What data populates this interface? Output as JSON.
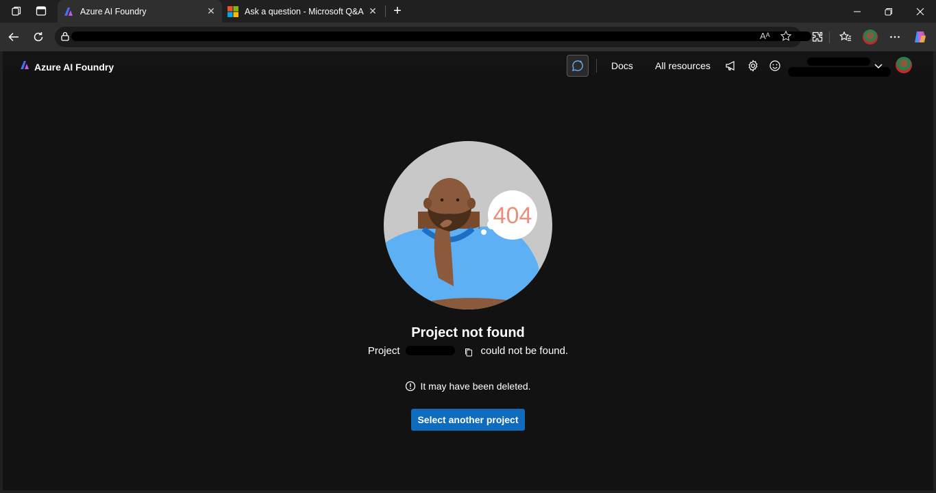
{
  "browser": {
    "tabs": [
      {
        "title": "Azure AI Foundry",
        "active": true
      },
      {
        "title": "Ask a question - Microsoft Q&A",
        "active": false
      }
    ],
    "new_tab_symbol": "+",
    "read_aloud_glyph": "Aᴬ"
  },
  "app": {
    "brand_title": "Azure AI Foundry",
    "nav": {
      "docs": "Docs",
      "all_resources": "All resources"
    }
  },
  "error": {
    "code": "404",
    "title": "Project not found",
    "message_prefix": "Project",
    "message_suffix": "could not be found.",
    "note": "It may have been deleted.",
    "action_label": "Select another project"
  },
  "colors": {
    "accent": "#0f6cbd",
    "app_background": "#121212",
    "error_code": "#e98e7a"
  },
  "icons": [
    "workspaces-icon",
    "vertical-tabs-icon",
    "back-arrow-icon",
    "refresh-icon",
    "lock-icon",
    "favorite-star-icon",
    "extensions-icon",
    "favorites-icon",
    "more-icon",
    "copilot-icon",
    "announcement-icon",
    "settings-gear-icon",
    "feedback-smiley-icon",
    "chevron-down-icon",
    "copy-icon",
    "info-icon"
  ]
}
